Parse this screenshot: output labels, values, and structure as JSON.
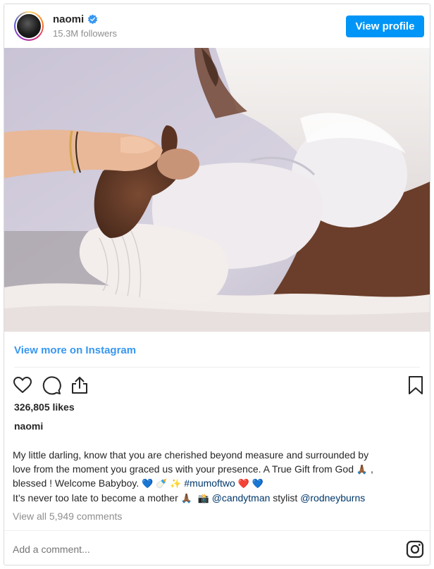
{
  "header": {
    "username": "naomi",
    "verified_icon": "verified-badge-icon",
    "followers": "15.3M followers",
    "view_profile_label": "View profile"
  },
  "photo": {
    "alt": "Hands holding a newborn baby in white clothing"
  },
  "view_more_label": "View more on Instagram",
  "actions": {
    "like_icon": "heart-icon",
    "comment_icon": "comment-icon",
    "share_icon": "share-icon",
    "save_icon": "bookmark-icon"
  },
  "likes": "326,805 likes",
  "caption": {
    "username": "naomi",
    "line1": "My little darling, know that you are cherished beyond measure and surrounded by",
    "line2": "love from the moment you graced us with your presence. A True Gift from God",
    "emoji_pray": "🙏🏾",
    "line3_pre": "blessed ! Welcome Babyboy.",
    "emoji_heart_blue": "💙",
    "emoji_bottle": "🍼",
    "emoji_sparkles": "✨",
    "hashtag": "#mumoftwo",
    "emoji_heart_red": "❤️",
    "line4_pre": "It’s never too late to become a mother",
    "emoji_camera": "📸",
    "mention1": "@candytman",
    "stylist_word": "stylist",
    "mention2": "@rodneyburns"
  },
  "comments_link": "View all 5,949 comments",
  "add_comment_placeholder": "Add a comment...",
  "instagram_icon": "instagram-logo-icon",
  "colors": {
    "accent": "#0095f6",
    "link": "#3897f0",
    "hashtag": "#00376b",
    "muted": "#8e8e8e"
  }
}
